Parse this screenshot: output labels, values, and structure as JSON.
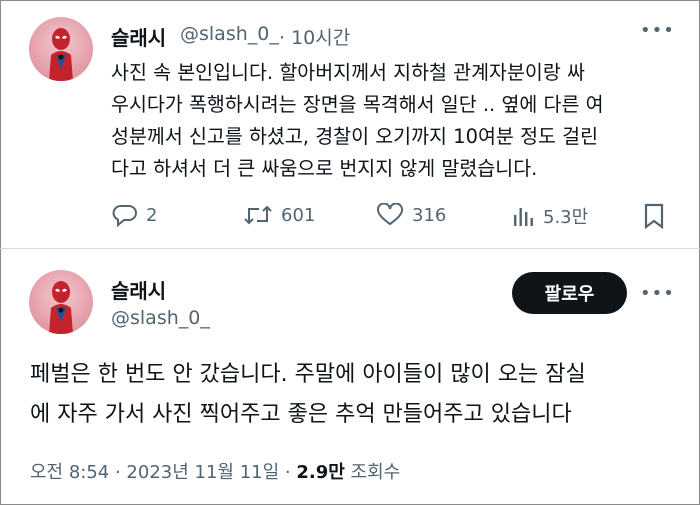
{
  "tweet1": {
    "user_name": "슬래시",
    "handle": "@slash_0_",
    "time": "· 10시간",
    "more_icon": "ellipsis-icon",
    "body_lines": [
      "사진 속 본인입니다. 할아버지께서 지하철 관계자분이랑 싸",
      "우시다가 폭행하시려는 장면을 목격해서 일단 .. 옆에 다른 여",
      "성분께서 신고를 하셨고, 경찰이 오기까지 10여분 정도 걸린",
      "다고 하셔서 더 큰 싸움으로 번지지 않게 말렸습니다."
    ],
    "actions": {
      "reply": {
        "icon": "reply-icon",
        "count": "2"
      },
      "retweet": {
        "icon": "retweet-icon",
        "count": "601"
      },
      "like": {
        "icon": "heart-icon",
        "count": "316"
      },
      "views": {
        "icon": "views-icon",
        "count": "5.3만"
      },
      "bookmark": {
        "icon": "bookmark-icon"
      }
    }
  },
  "tweet2": {
    "user_name": "슬래시",
    "handle": "@slash_0_",
    "follow_label": "팔로우",
    "more_icon": "ellipsis-icon",
    "body_lines": [
      "페벌은 한 번도 안 갔습니다. 주말에 아이들이 많이 오는 잠실",
      "에 자주 가서 사진 찍어주고 좋은 추억 만들어주고 있습니다"
    ],
    "meta_time": "오전 8:54 · 2023년 11월 11일 · ",
    "meta_views": "2.9만",
    "meta_views_label": " 조회수"
  },
  "colors": {
    "text": "#0f1419",
    "secondary": "#536471",
    "divider": "#cfd9de",
    "avatar_bg": "#e6a3ad",
    "follow_bg": "#0f1419"
  }
}
